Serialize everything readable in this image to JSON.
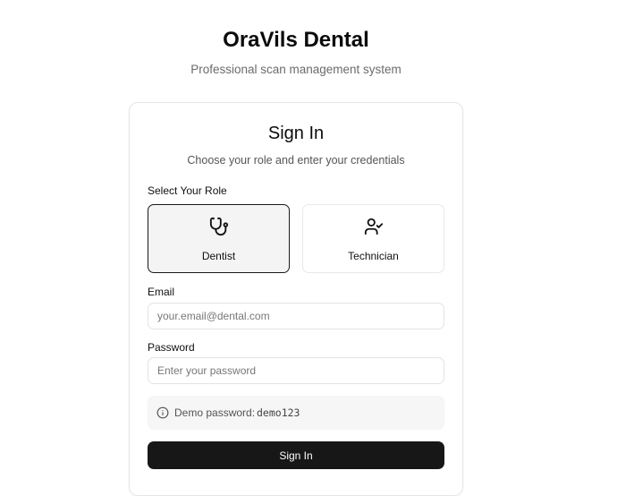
{
  "header": {
    "title": "OraVils Dental",
    "subtitle": "Professional scan management system"
  },
  "card": {
    "title": "Sign In",
    "description": "Choose your role and enter your credentials"
  },
  "role": {
    "label": "Select Your Role",
    "options": [
      {
        "label": "Dentist",
        "icon": "stethoscope-icon",
        "selected": true
      },
      {
        "label": "Technician",
        "icon": "user-check-icon",
        "selected": false
      }
    ]
  },
  "email": {
    "label": "Email",
    "value": "",
    "placeholder": "your.email@dental.com"
  },
  "password": {
    "label": "Password",
    "value": "",
    "placeholder": "Enter your password"
  },
  "demo": {
    "icon": "info-icon",
    "text": "Demo password:",
    "code": "demo123"
  },
  "submit": {
    "label": "Sign In"
  },
  "colors": {
    "primary": "#171717",
    "muted_text": "#6b6b6b",
    "card_border": "#e6e6e6",
    "selected_bg": "#f4f4f4"
  }
}
